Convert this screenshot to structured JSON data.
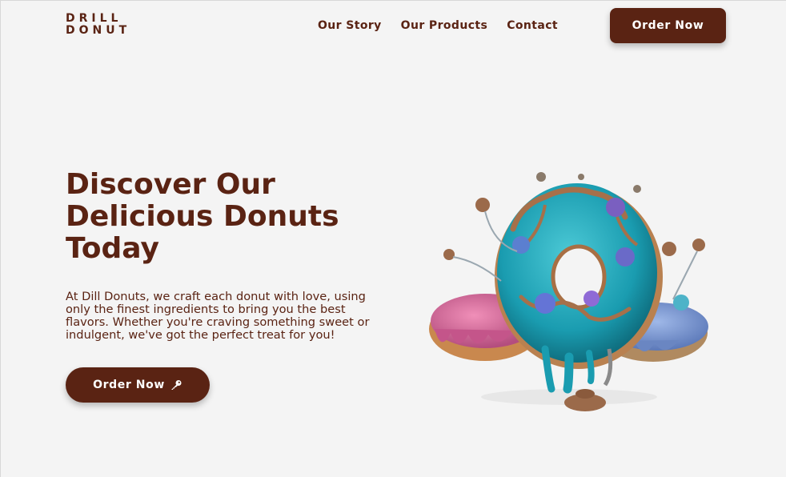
{
  "brand": {
    "line1": "DRILL",
    "line2": "DONUT"
  },
  "nav": {
    "items": [
      {
        "label": "Our Story"
      },
      {
        "label": "Our Products"
      },
      {
        "label": "Contact"
      }
    ],
    "order_button": "Order Now"
  },
  "hero": {
    "title_lines": [
      "Discover Our",
      "Delicious Donuts",
      "Today"
    ],
    "description_lines": [
      "At Dill Donuts, we craft each donut with love, using",
      "only the finest ingredients to bring you the best",
      "flavors. Whether you're craving something sweet or",
      "indulgent, we've got the perfect treat for you!"
    ],
    "cta_label": "Order Now",
    "cta_icon": "key-icon",
    "image": "donut-splash-illustration"
  },
  "colors": {
    "brand_brown": "#5a2313",
    "background": "#f4f4f4",
    "donut_teal": "#1fa6b8",
    "donut_pink": "#d46a9a",
    "chocolate": "#9b6a4a"
  }
}
